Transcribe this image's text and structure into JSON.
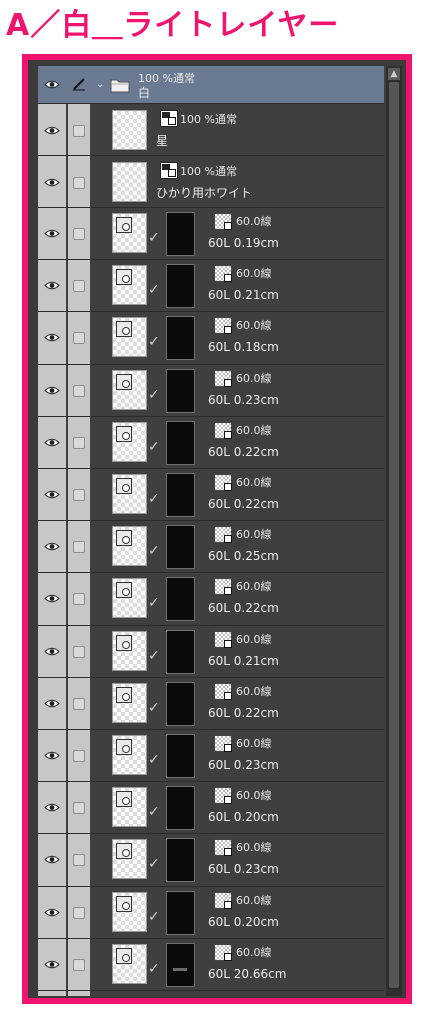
{
  "caption": "A／白＿ライトレイヤー",
  "folder": {
    "opacity_blend": "100 %通常",
    "name": "白"
  },
  "raster_layers": [
    {
      "opacity_blend": "100 %通常",
      "name": "星"
    },
    {
      "opacity_blend": "100 %通常",
      "name": "ひかり用ホワイト"
    }
  ],
  "vector_layers": [
    {
      "opacity_blend": "60.0線",
      "name": "60L 0.19cm"
    },
    {
      "opacity_blend": "60.0線",
      "name": "60L 0.21cm"
    },
    {
      "opacity_blend": "60.0線",
      "name": "60L 0.18cm"
    },
    {
      "opacity_blend": "60.0線",
      "name": "60L 0.23cm"
    },
    {
      "opacity_blend": "60.0線",
      "name": "60L 0.22cm"
    },
    {
      "opacity_blend": "60.0線",
      "name": "60L 0.22cm"
    },
    {
      "opacity_blend": "60.0線",
      "name": "60L 0.25cm"
    },
    {
      "opacity_blend": "60.0線",
      "name": "60L 0.22cm"
    },
    {
      "opacity_blend": "60.0線",
      "name": "60L 0.21cm"
    },
    {
      "opacity_blend": "60.0線",
      "name": "60L 0.22cm"
    },
    {
      "opacity_blend": "60.0線",
      "name": "60L 0.23cm"
    },
    {
      "opacity_blend": "60.0線",
      "name": "60L 0.20cm"
    },
    {
      "opacity_blend": "60.0線",
      "name": "60L 0.23cm"
    },
    {
      "opacity_blend": "60.0線",
      "name": "60L 0.20cm"
    },
    {
      "opacity_blend": "60.0線",
      "name": "60L 20.66cm"
    }
  ],
  "colors": {
    "accent_frame": "#f0146e",
    "folder_bg": "#6a7a92",
    "panel_bg": "#3f3f3f"
  },
  "icons": {
    "visibility": "eye-icon",
    "edit": "pen-icon",
    "folder": "folder-icon"
  }
}
